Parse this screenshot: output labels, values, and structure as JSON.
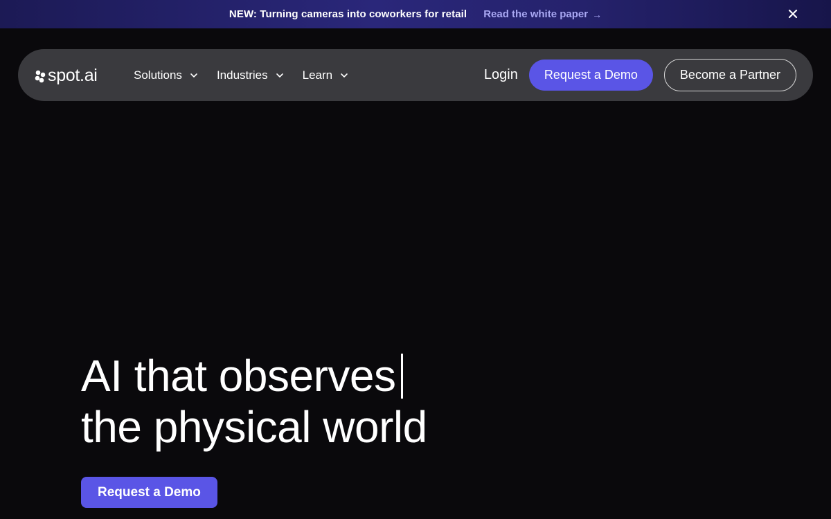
{
  "announcement": {
    "text": "NEW: Turning cameras into coworkers for retail",
    "link_label": "Read the white paper",
    "link_arrow": "→",
    "close_icon": "close-icon"
  },
  "navbar": {
    "logo_text": "spot.ai",
    "logo_icon": "spot-dots-icon",
    "menu": [
      {
        "label": "Solutions",
        "icon": "chevron-down-icon"
      },
      {
        "label": "Industries",
        "icon": "chevron-down-icon"
      },
      {
        "label": "Learn",
        "icon": "chevron-down-icon"
      }
    ],
    "login_label": "Login",
    "demo_label": "Request a Demo",
    "partner_label": "Become a Partner"
  },
  "hero": {
    "line1": "AI that observes",
    "line2": "the physical world",
    "cta_label": "Request a Demo"
  },
  "colors": {
    "background": "#0a090c",
    "navbar_bg": "#3a3a3e",
    "accent": "#5a55e6",
    "link": "#a8a7f2",
    "announce_bg": "#2a277a"
  }
}
